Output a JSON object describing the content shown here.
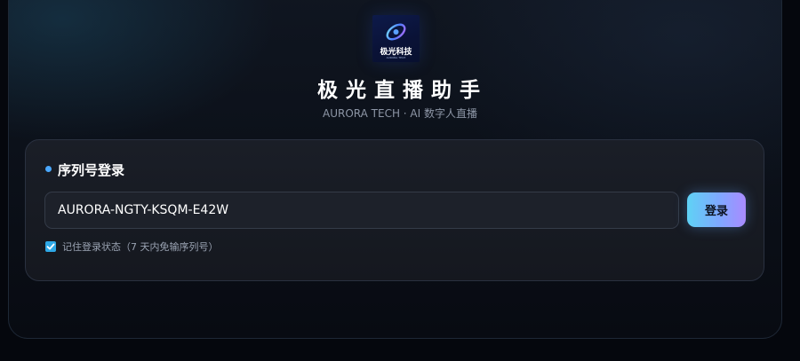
{
  "app": {
    "logo_text": "极光科技",
    "logo_subtext": "AURORA TECH",
    "title": "极光直播助手",
    "subtitle": "AURORA TECH · AI 数字人直播"
  },
  "login_card": {
    "heading": "序列号登录",
    "serial_input_value": "AURORA-NGTY-KSQM-E42W",
    "login_button_label": "登录",
    "remember_checked": true,
    "remember_label": "记住登录状态（7 天内免输序列号）"
  },
  "colors": {
    "accent_dot": "#4aa8ff",
    "button_gradient_start": "#5fd2f5",
    "button_gradient_end": "#a98bff",
    "checkbox": "#2ea8e6"
  },
  "icons": {
    "logo": "aurora-ring-icon",
    "checkbox": "checkmark-icon"
  }
}
